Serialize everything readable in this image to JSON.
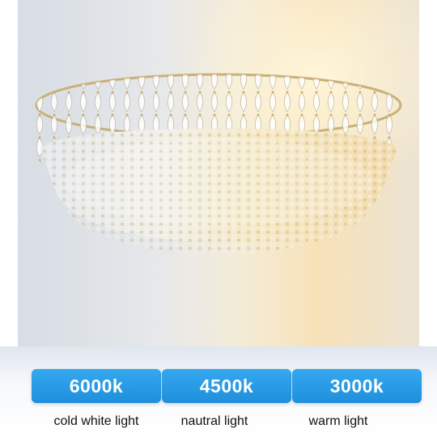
{
  "options": [
    {
      "temperature": "6000k",
      "description": "cold white light"
    },
    {
      "temperature": "4500k",
      "description": "nautral light"
    },
    {
      "temperature": "3000k",
      "description": "warm light"
    }
  ],
  "colors": {
    "badge": "#2a9be6",
    "badge_text": "#ffffff",
    "cold_tone": "#dfe7ef",
    "neutral_tone": "#f3ead2",
    "warm_tone": "#f8d8a0"
  }
}
